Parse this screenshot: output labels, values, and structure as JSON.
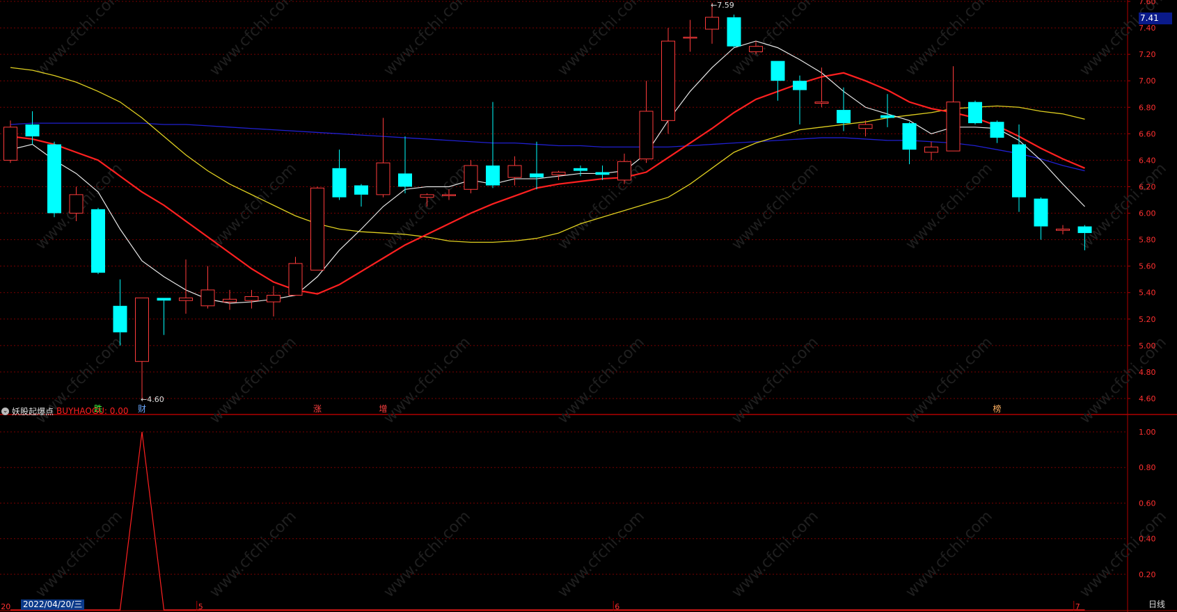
{
  "indicator": {
    "name": "妖股起爆点",
    "buy_label": "BUYHAOGU: 0.00",
    "icon": "collapse-circle-icon"
  },
  "period_button": "日线",
  "cursor_date": "2022/04/20/三",
  "current_price_tag": "7.41",
  "month_labels": [
    {
      "label": "20",
      "bar": -0.5
    },
    {
      "label": "5",
      "bar": 8.5
    },
    {
      "label": "6",
      "bar": 27.5
    },
    {
      "label": "7",
      "bar": 48.5
    }
  ],
  "extreme_labels": {
    "high": "7.59",
    "low": "4.60"
  },
  "news_tags": [
    {
      "label": "跌",
      "bar": 4,
      "color": "#40ff40"
    },
    {
      "label": "财",
      "bar": 6,
      "color": "#6aa8ff"
    },
    {
      "label": "涨",
      "bar": 14,
      "color": "#ff4040"
    },
    {
      "label": "增",
      "bar": 17,
      "color": "#ff4040"
    },
    {
      "label": "榜",
      "bar": 45,
      "color": "#ffb060"
    }
  ],
  "price_axis_labels": [
    "7.60",
    "7.40",
    "7.20",
    "7.00",
    "6.80",
    "6.60",
    "6.40",
    "6.20",
    "6.00",
    "5.80",
    "5.60",
    "5.40",
    "5.20",
    "5.00",
    "4.80",
    "4.60"
  ],
  "indicator_axis_labels": [
    "1.00",
    "0.80",
    "0.60",
    "0.40",
    "0.20"
  ],
  "watermark": "www.cfchi.com",
  "colors": {
    "up": "#ff3b3b",
    "down": "#00ffff",
    "ma5": "#e8e8e8",
    "ma10": "#ff2020",
    "ma30": "#e0d020",
    "ma60": "#2020d0",
    "grid": "#7a0000",
    "axis_text": "#ff3030"
  },
  "chart_data": {
    "type": "candlestick",
    "ylim": [
      4.5,
      7.65
    ],
    "candles": [
      {
        "o": 6.4,
        "c": 6.65,
        "h": 6.7,
        "l": 6.38
      },
      {
        "o": 6.67,
        "c": 6.58,
        "h": 6.77,
        "l": 6.52
      },
      {
        "o": 6.52,
        "c": 6.0,
        "h": 6.54,
        "l": 5.97
      },
      {
        "o": 6.0,
        "c": 6.14,
        "h": 6.2,
        "l": 5.94
      },
      {
        "o": 6.03,
        "c": 5.55,
        "h": 6.04,
        "l": 5.54
      },
      {
        "o": 5.3,
        "c": 5.1,
        "h": 5.5,
        "l": 5.0
      },
      {
        "o": 4.88,
        "c": 5.36,
        "h": 5.36,
        "l": 4.6
      },
      {
        "o": 5.36,
        "c": 5.34,
        "h": 5.36,
        "l": 5.08
      },
      {
        "o": 5.34,
        "c": 5.36,
        "h": 5.65,
        "l": 5.24
      },
      {
        "o": 5.3,
        "c": 5.42,
        "h": 5.6,
        "l": 5.28
      },
      {
        "o": 5.33,
        "c": 5.35,
        "h": 5.42,
        "l": 5.27
      },
      {
        "o": 5.34,
        "c": 5.37,
        "h": 5.42,
        "l": 5.28
      },
      {
        "o": 5.33,
        "c": 5.38,
        "h": 5.45,
        "l": 5.22
      },
      {
        "o": 5.38,
        "c": 5.62,
        "h": 5.67,
        "l": 5.38
      },
      {
        "o": 5.57,
        "c": 6.19,
        "h": 6.2,
        "l": 5.57
      },
      {
        "o": 6.34,
        "c": 6.12,
        "h": 6.48,
        "l": 6.1
      },
      {
        "o": 6.21,
        "c": 6.14,
        "h": 6.22,
        "l": 6.05
      },
      {
        "o": 6.14,
        "c": 6.38,
        "h": 6.72,
        "l": 6.12
      },
      {
        "o": 6.3,
        "c": 6.2,
        "h": 6.58,
        "l": 6.15
      },
      {
        "o": 6.12,
        "c": 6.14,
        "h": 6.15,
        "l": 6.05
      },
      {
        "o": 6.14,
        "c": 6.14,
        "h": 6.18,
        "l": 6.1
      },
      {
        "o": 6.18,
        "c": 6.36,
        "h": 6.4,
        "l": 6.15
      },
      {
        "o": 6.36,
        "c": 6.21,
        "h": 6.84,
        "l": 6.19
      },
      {
        "o": 6.27,
        "c": 6.36,
        "h": 6.43,
        "l": 6.21
      },
      {
        "o": 6.3,
        "c": 6.27,
        "h": 6.54,
        "l": 6.18
      },
      {
        "o": 6.29,
        "c": 6.31,
        "h": 6.32,
        "l": 6.25
      },
      {
        "o": 6.34,
        "c": 6.32,
        "h": 6.36,
        "l": 6.28
      },
      {
        "o": 6.31,
        "c": 6.29,
        "h": 6.36,
        "l": 6.25
      },
      {
        "o": 6.25,
        "c": 6.39,
        "h": 6.45,
        "l": 6.22
      },
      {
        "o": 6.41,
        "c": 6.77,
        "h": 7.0,
        "l": 6.38
      },
      {
        "o": 6.7,
        "c": 7.3,
        "h": 7.4,
        "l": 6.6
      },
      {
        "o": 7.33,
        "c": 7.33,
        "h": 7.46,
        "l": 7.22
      },
      {
        "o": 7.39,
        "c": 7.48,
        "h": 7.59,
        "l": 7.28
      },
      {
        "o": 7.48,
        "c": 7.26,
        "h": 7.5,
        "l": 7.25
      },
      {
        "o": 7.22,
        "c": 7.26,
        "h": 7.3,
        "l": 7.2
      },
      {
        "o": 7.15,
        "c": 7.0,
        "h": 7.15,
        "l": 6.85
      },
      {
        "o": 7.0,
        "c": 6.93,
        "h": 7.04,
        "l": 6.67
      },
      {
        "o": 6.83,
        "c": 6.84,
        "h": 7.1,
        "l": 6.8
      },
      {
        "o": 6.78,
        "c": 6.68,
        "h": 6.95,
        "l": 6.62
      },
      {
        "o": 6.64,
        "c": 6.67,
        "h": 6.7,
        "l": 6.58
      },
      {
        "o": 6.74,
        "c": 6.72,
        "h": 6.9,
        "l": 6.65
      },
      {
        "o": 6.68,
        "c": 6.48,
        "h": 6.69,
        "l": 6.37
      },
      {
        "o": 6.46,
        "c": 6.5,
        "h": 6.54,
        "l": 6.4
      },
      {
        "o": 6.47,
        "c": 6.84,
        "h": 7.11,
        "l": 6.47
      },
      {
        "o": 6.84,
        "c": 6.68,
        "h": 6.85,
        "l": 6.67
      },
      {
        "o": 6.69,
        "c": 6.57,
        "h": 6.7,
        "l": 6.53
      },
      {
        "o": 6.52,
        "c": 6.12,
        "h": 6.67,
        "l": 6.01
      },
      {
        "o": 6.11,
        "c": 5.9,
        "h": 6.12,
        "l": 5.8
      },
      {
        "o": 5.87,
        "c": 5.88,
        "h": 5.91,
        "l": 5.84
      },
      {
        "o": 5.9,
        "c": 5.85,
        "h": 5.91,
        "l": 5.72
      }
    ],
    "ma5": [
      6.48,
      6.52,
      6.4,
      6.3,
      6.16,
      5.88,
      5.64,
      5.52,
      5.42,
      5.35,
      5.32,
      5.33,
      5.35,
      5.38,
      5.52,
      5.72,
      5.88,
      6.05,
      6.18,
      6.2,
      6.2,
      6.25,
      6.22,
      6.26,
      6.26,
      6.28,
      6.3,
      6.3,
      6.32,
      6.45,
      6.7,
      6.92,
      7.1,
      7.25,
      7.3,
      7.25,
      7.16,
      7.06,
      6.92,
      6.8,
      6.75,
      6.7,
      6.6,
      6.65,
      6.65,
      6.64,
      6.55,
      6.4,
      6.22,
      6.05
    ],
    "ma10": [
      6.58,
      6.56,
      6.52,
      6.46,
      6.4,
      6.28,
      6.16,
      6.06,
      5.94,
      5.82,
      5.7,
      5.58,
      5.48,
      5.42,
      5.39,
      5.46,
      5.56,
      5.66,
      5.76,
      5.84,
      5.92,
      6.0,
      6.07,
      6.13,
      6.19,
      6.22,
      6.24,
      6.26,
      6.27,
      6.31,
      6.42,
      6.53,
      6.64,
      6.76,
      6.86,
      6.92,
      6.98,
      7.03,
      7.06,
      7.0,
      6.93,
      6.84,
      6.79,
      6.76,
      6.72,
      6.66,
      6.58,
      6.49,
      6.41,
      6.34
    ],
    "ma30": [
      7.1,
      7.08,
      7.04,
      6.99,
      6.92,
      6.84,
      6.72,
      6.58,
      6.44,
      6.32,
      6.22,
      6.14,
      6.06,
      5.98,
      5.92,
      5.88,
      5.86,
      5.85,
      5.84,
      5.82,
      5.79,
      5.78,
      5.78,
      5.79,
      5.81,
      5.85,
      5.92,
      5.97,
      6.02,
      6.07,
      6.12,
      6.22,
      6.34,
      6.46,
      6.53,
      6.58,
      6.63,
      6.65,
      6.67,
      6.69,
      6.72,
      6.74,
      6.76,
      6.79,
      6.8,
      6.81,
      6.8,
      6.77,
      6.75,
      6.71
    ],
    "ma60": [
      6.67,
      6.68,
      6.68,
      6.68,
      6.68,
      6.68,
      6.68,
      6.67,
      6.67,
      6.66,
      6.65,
      6.64,
      6.63,
      6.62,
      6.61,
      6.6,
      6.59,
      6.58,
      6.57,
      6.56,
      6.55,
      6.54,
      6.53,
      6.53,
      6.52,
      6.51,
      6.51,
      6.5,
      6.5,
      6.5,
      6.5,
      6.51,
      6.52,
      6.53,
      6.54,
      6.55,
      6.56,
      6.57,
      6.57,
      6.56,
      6.55,
      6.55,
      6.54,
      6.53,
      6.51,
      6.48,
      6.45,
      6.41,
      6.36,
      6.32
    ],
    "buyhaogu": [
      0,
      0,
      0,
      0,
      0,
      0,
      1,
      0,
      0,
      0,
      0,
      0,
      0,
      0,
      0,
      0,
      0,
      0,
      0,
      0,
      0,
      0,
      0,
      0,
      0,
      0,
      0,
      0,
      0,
      0,
      0,
      0,
      0,
      0,
      0,
      0,
      0,
      0,
      0,
      0,
      0,
      0,
      0,
      0,
      0,
      0,
      0,
      0,
      0,
      0
    ]
  }
}
